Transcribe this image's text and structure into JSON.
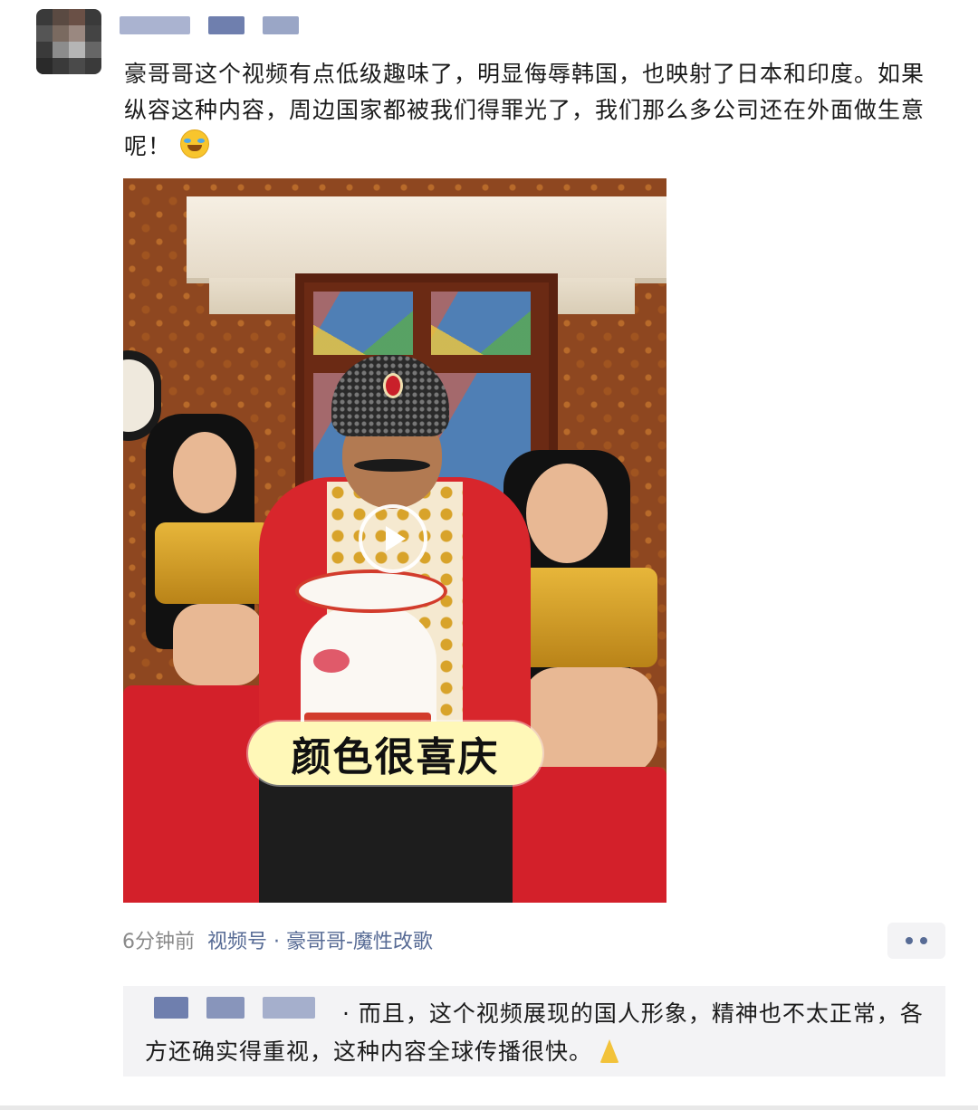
{
  "post": {
    "text": "豪哥哥这个视频有点低级趣味了，明显侮辱韩国，也映射了日本和印度。如果纵容这种内容，周边国家都被我们得罪光了，我们那么多公司还在外面做生意呢！",
    "emoji_icon": "laughing-tears-emoji"
  },
  "video": {
    "caption": "颜色很喜庆",
    "play_icon": "play-icon"
  },
  "meta": {
    "time": "6分钟前",
    "source": "视频号 · 豪哥哥-魔性改歌",
    "more_icon": "more-dots-icon"
  },
  "comment": {
    "text": "· 而且，这个视频展现的国人形象，精神也不太正常，各方还确实得重视，这种内容全球传播很快。",
    "emoji_icon": "folded-hands-emoji"
  },
  "colors": {
    "link_blue": "#576b95",
    "meta_gray": "#8a8a8a",
    "comment_bg": "#f3f3f5"
  }
}
